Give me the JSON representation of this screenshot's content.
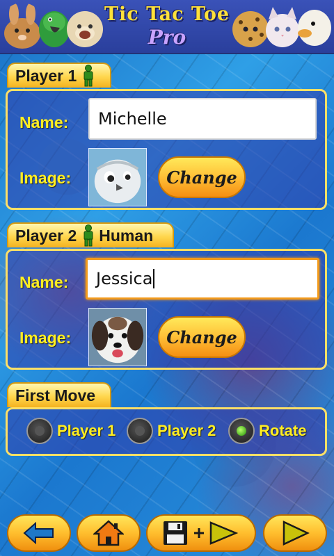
{
  "banner": {
    "title_line1": "Tic Tac Toe",
    "title_line2": "Pro"
  },
  "player1": {
    "tab_label": "Player 1",
    "name_label": "Name:",
    "name_value": "Michelle",
    "image_label": "Image:",
    "change_label": "Change"
  },
  "player2": {
    "tab_label": "Player 2",
    "type_label": "Human",
    "name_label": "Name:",
    "name_value": "Jessica",
    "image_label": "Image:",
    "change_label": "Change"
  },
  "first_move": {
    "tab_label": "First Move",
    "options": [
      {
        "label": "Player 1",
        "selected": false
      },
      {
        "label": "Player 2",
        "selected": false
      },
      {
        "label": "Rotate",
        "selected": true
      }
    ]
  },
  "nav": {
    "icons": [
      "back-arrow-icon",
      "home-icon",
      "save-play-icon",
      "play-icon"
    ]
  },
  "colors": {
    "accent_yellow": "#ffee22",
    "button_orange": "#f0900f",
    "panel_border": "#ffe066",
    "human_icon_green": "#2e8b1c"
  }
}
